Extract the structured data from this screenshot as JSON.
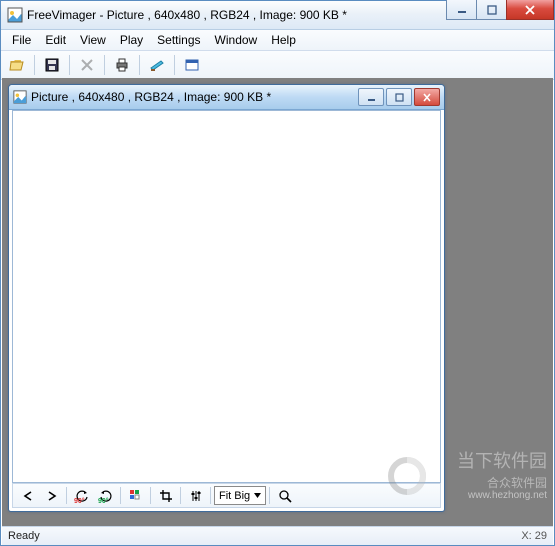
{
  "window": {
    "title": "FreeVimager - Picture , 640x480 , RGB24 , Image: 900 KB *"
  },
  "menu": [
    "File",
    "Edit",
    "View",
    "Play",
    "Settings",
    "Window",
    "Help"
  ],
  "toolbar": {
    "open": "open-icon",
    "save": "save-icon",
    "delete": "delete-icon",
    "print": "print-icon",
    "scan": "scan-icon",
    "fullscreen": "fullscreen-icon"
  },
  "child": {
    "title": "Picture , 640x480 , RGB24 , Image: 900 KB *",
    "fit": "Fit Big",
    "rot_ccw": "90°",
    "rot_cw": "90°"
  },
  "status": {
    "left": "Ready",
    "right": "X: 29"
  },
  "watermark": {
    "line1": "当下软件园",
    "line2": "合众软件园",
    "line3": "www.hezhong.net"
  },
  "colors": {
    "red": "#d44a3c",
    "green": "#2e9b3a",
    "blue": "#2f6bd8"
  }
}
